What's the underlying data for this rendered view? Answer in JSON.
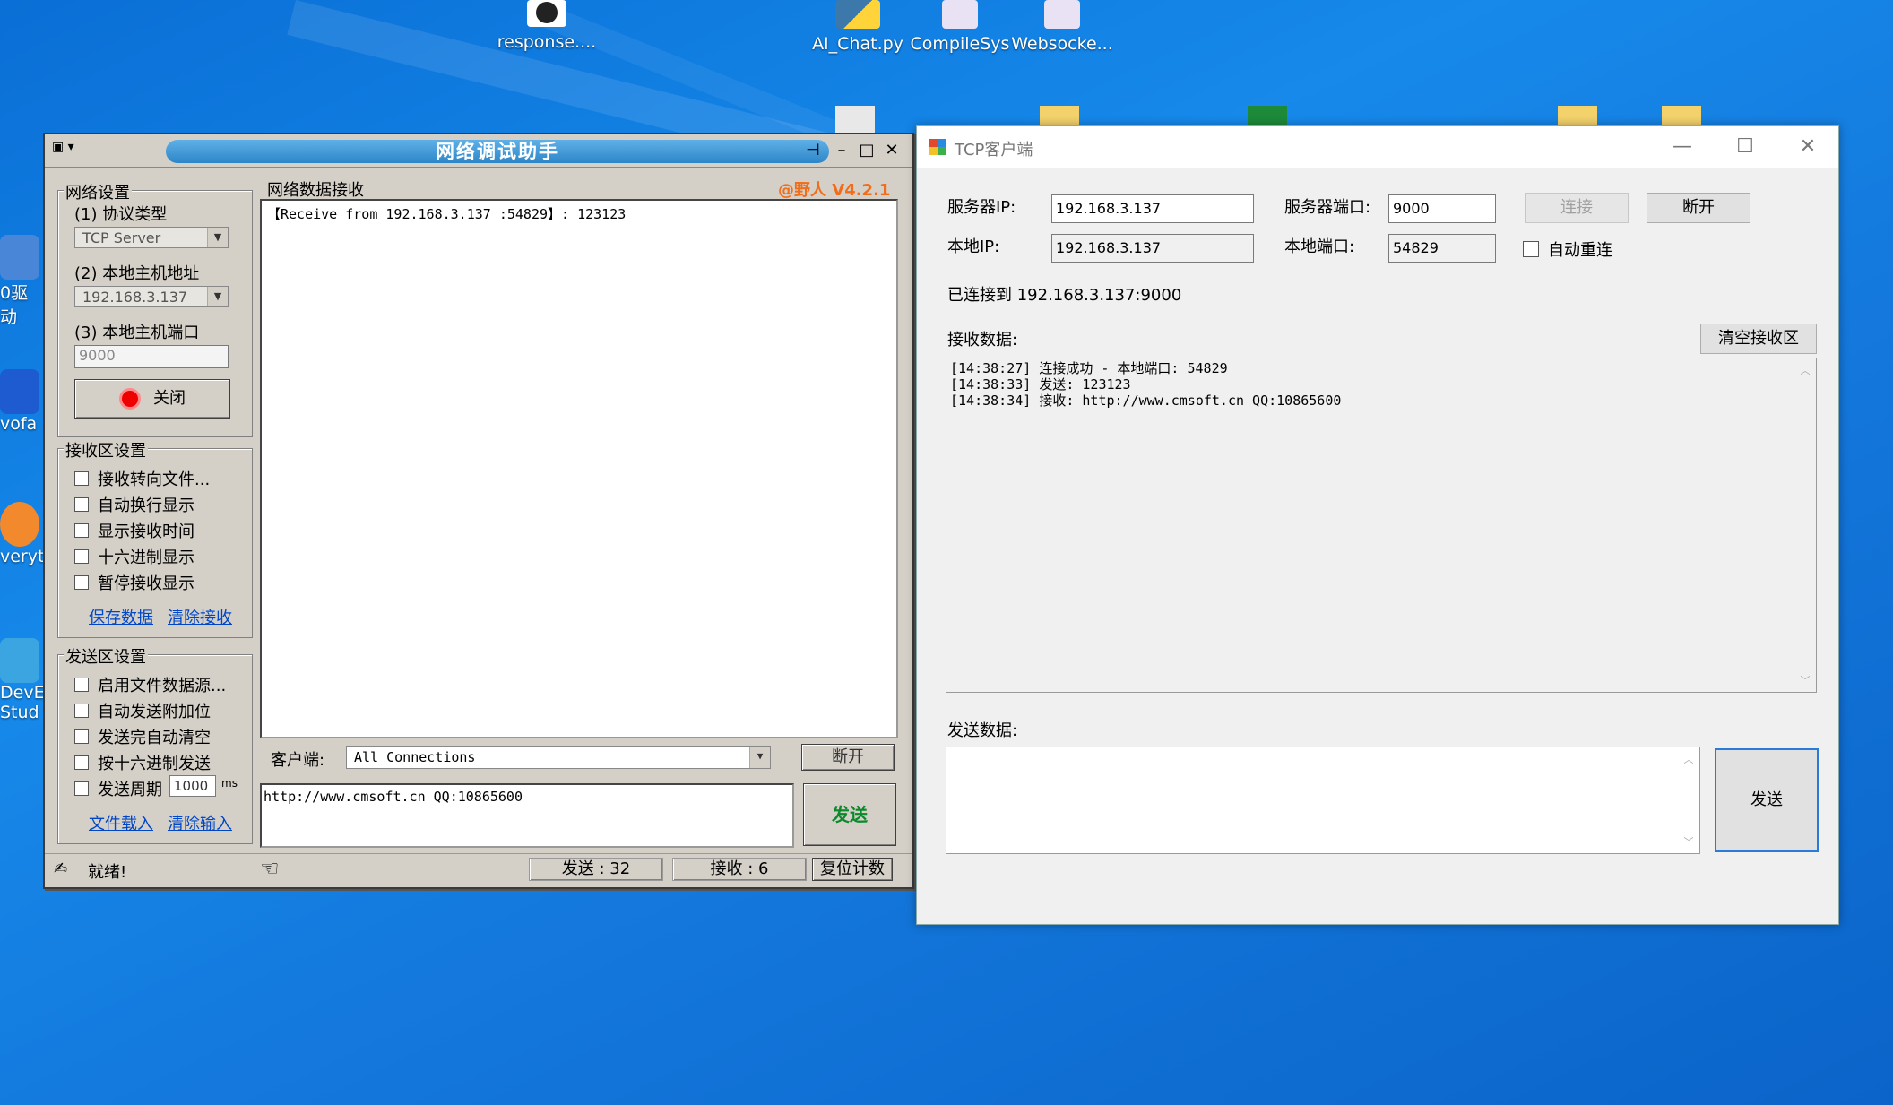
{
  "desktop": {
    "icons": [
      {
        "label": "response...."
      },
      {
        "label": "AI_Chat.py"
      },
      {
        "label": "CompileSys"
      },
      {
        "label": "Websocke..."
      }
    ],
    "left_icons": [
      {
        "label": "0驱动"
      },
      {
        "label": "vofa"
      },
      {
        "label": "veryth"
      },
      {
        "label": "DevE"
      },
      {
        "label": "Stud"
      }
    ]
  },
  "netassist": {
    "title": "网络调试助手",
    "version": "@野人 V4.2.1",
    "net_settings": {
      "legend": "网络设置",
      "protocol_label": "(1) 协议类型",
      "protocol_value": "TCP Server",
      "host_label": "(2) 本地主机地址",
      "host_value": "192.168.3.137",
      "port_label": "(3) 本地主机端口",
      "port_value": "9000",
      "close_button": "关闭"
    },
    "recv_settings": {
      "legend": "接收区设置",
      "options": [
        "接收转向文件...",
        "自动换行显示",
        "显示接收时间",
        "十六进制显示",
        "暂停接收显示"
      ],
      "save_link": "保存数据",
      "clear_link": "清除接收"
    },
    "send_settings": {
      "legend": "发送区设置",
      "options": [
        "启用文件数据源...",
        "自动发送附加位",
        "发送完自动清空",
        "按十六进制发送"
      ],
      "period_label": "发送周期",
      "period_value": "1000",
      "period_unit": "ms",
      "load_link": "文件载入",
      "clear_link": "清除输入"
    },
    "recv_area": {
      "legend": "网络数据接收",
      "content": "【Receive from 192.168.3.137 :54829】: 123123"
    },
    "client_label": "客户端:",
    "client_value": "All Connections",
    "disconnect_button": "断开",
    "send_text": "http://www.cmsoft.cn QQ:10865600",
    "send_button": "发送",
    "status": "就绪!",
    "sent_label": "发送 : 32",
    "recv_label": "接收 : 6",
    "reset_button": "复位计数"
  },
  "tcpclient": {
    "title": "TCP客户端",
    "server_ip_label": "服务器IP:",
    "server_ip_value": "192.168.3.137",
    "server_port_label": "服务器端口:",
    "server_port_value": "9000",
    "connect_button": "连接",
    "disconnect_button": "断开",
    "local_ip_label": "本地IP:",
    "local_ip_value": "192.168.3.137",
    "local_port_label": "本地端口:",
    "local_port_value": "54829",
    "auto_reconnect": "自动重连",
    "status": "已连接到 192.168.3.137:9000",
    "recv_label": "接收数据:",
    "clear_button": "清空接收区",
    "log": [
      "[14:38:27] 连接成功 - 本地端口: 54829",
      "[14:38:33] 发送: 123123",
      "[14:38:34] 接收: http://www.cmsoft.cn QQ:10865600"
    ],
    "send_label": "发送数据:",
    "send_button": "发送"
  }
}
